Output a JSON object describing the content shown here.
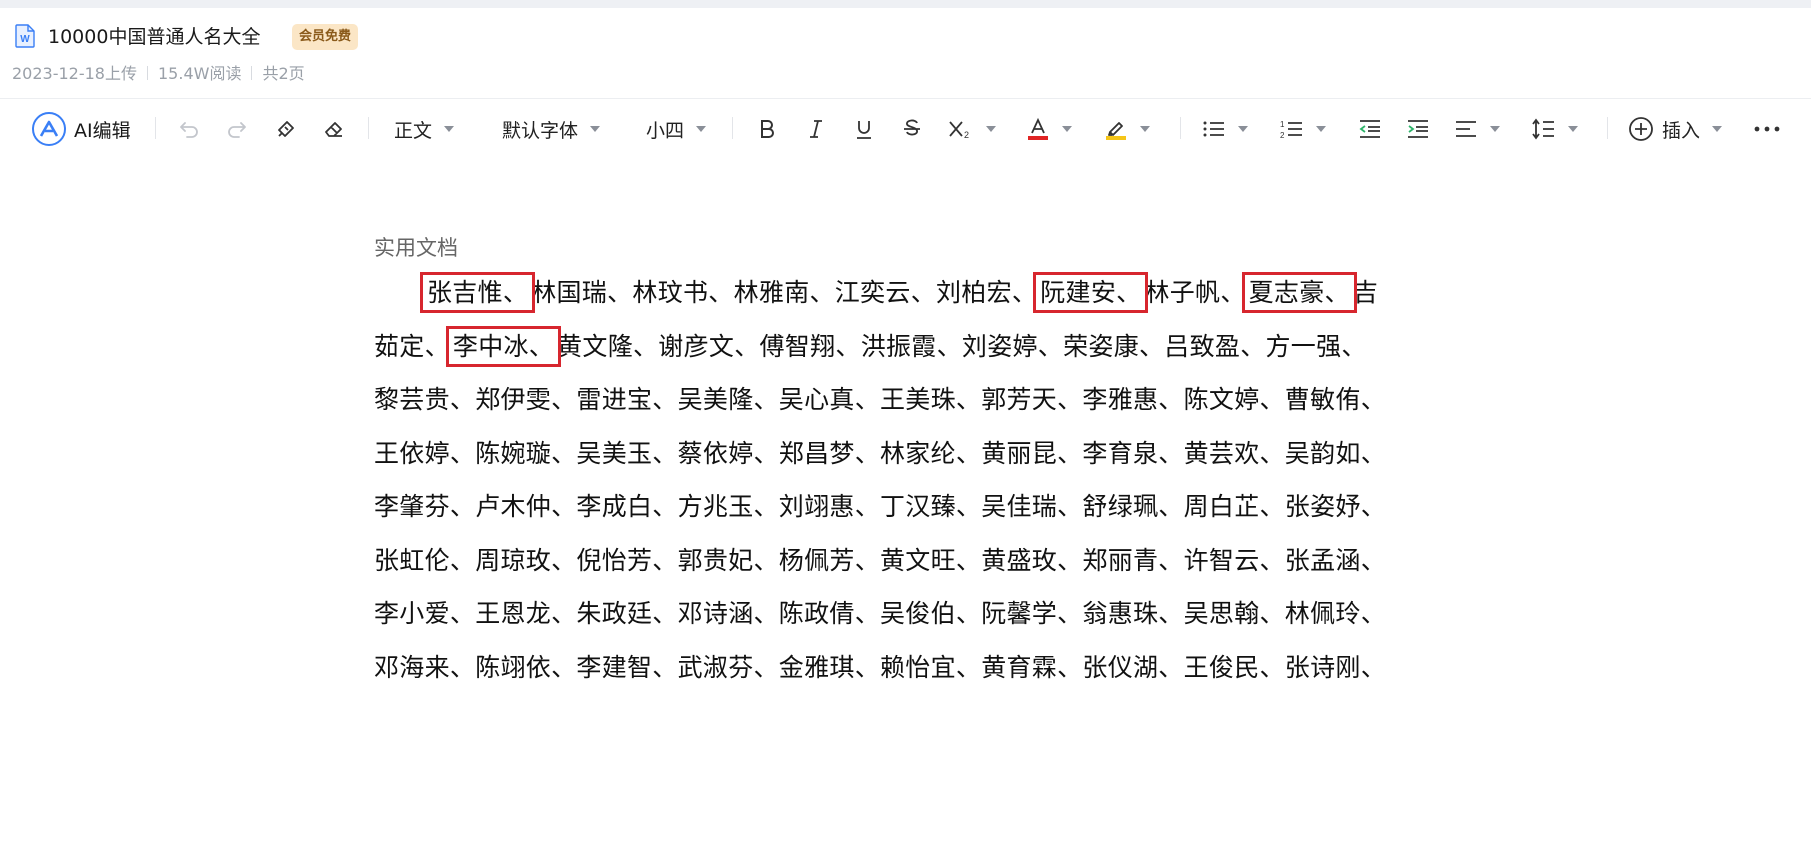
{
  "document": {
    "title": "10000中国普通人名大全",
    "badge": "会员免费",
    "upload_date": "2023-12-18上传",
    "reads": "15.4W阅读",
    "pages": "共2页"
  },
  "toolbar": {
    "ai_label": "AI编辑",
    "paragraph_style": "正文",
    "font_family": "默认字体",
    "font_size": "小四",
    "insert_label": "插入",
    "colors": {
      "font_color": "#e02424",
      "highlight_color": "#f5c518",
      "ai_blue": "#3a7ff6"
    }
  },
  "content": {
    "page_label": "实用文档",
    "lines": [
      [
        "张吉惟、",
        "林国瑞、林玟书、林雅南、江奕云、刘柏宏、",
        "阮建安、",
        "林子帆、",
        "夏志豪、",
        "吉"
      ],
      [
        "茹定、",
        "李中冰、",
        "黄文隆、谢彦文、傅智翔、洪振霞、刘姿婷、荣姿康、吕致盈、方一强、"
      ],
      [
        "黎芸贵、郑伊雯、雷进宝、吴美隆、吴心真、王美珠、郭芳天、李雅惠、陈文婷、曹敏侑、"
      ],
      [
        "王依婷、陈婉璇、吴美玉、蔡依婷、郑昌梦、林家纶、黄丽昆、李育泉、黄芸欢、吴韵如、"
      ],
      [
        "李肇芬、卢木仲、李成白、方兆玉、刘翊惠、丁汉臻、吴佳瑞、舒绿珮、周白芷、张姿妤、"
      ],
      [
        "张虹伦、周琼玫、倪怡芳、郭贵妃、杨佩芳、黄文旺、黄盛玫、郑丽青、许智云、张孟涵、"
      ],
      [
        "李小爱、王恩龙、朱政廷、邓诗涵、陈政倩、吴俊伯、阮馨学、翁惠珠、吴思翰、林佩玲、"
      ],
      [
        "邓海来、陈翊依、李建智、武淑芬、金雅琪、赖怡宜、黄育霖、张仪湖、王俊民、张诗刚、"
      ]
    ],
    "highlight_color": "#d7262e"
  }
}
